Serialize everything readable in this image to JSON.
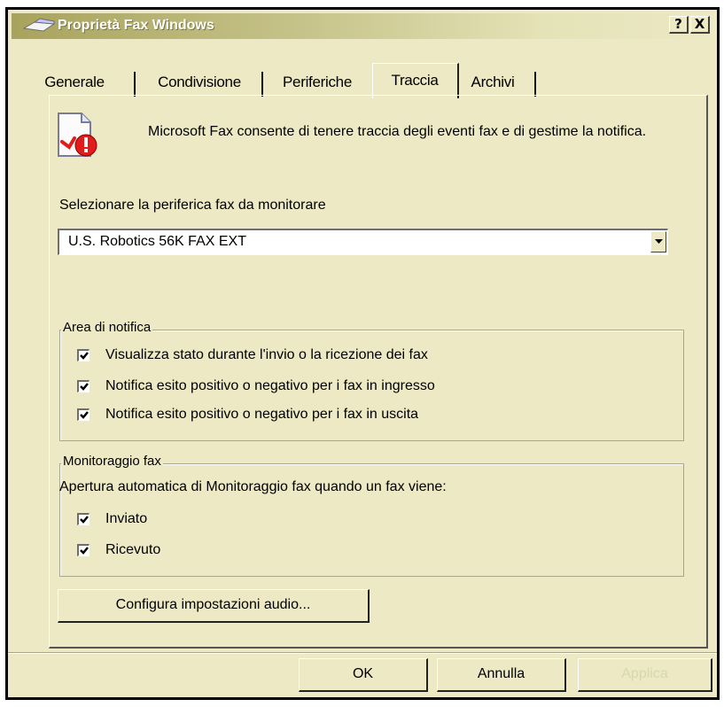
{
  "window": {
    "title": "Proprietà Fax Windows",
    "help_label": "?",
    "close_label": "X"
  },
  "tabs": [
    {
      "label": "Generale",
      "active": false
    },
    {
      "label": "Condivisione",
      "active": false
    },
    {
      "label": "Periferiche",
      "active": false
    },
    {
      "label": "Traccia",
      "active": true
    },
    {
      "label": "Archivi",
      "active": false
    }
  ],
  "intro": {
    "icon": "fax-tracking-icon",
    "text": "Microsoft Fax consente di tenere traccia degli eventi fax e di gestime la notifica."
  },
  "device": {
    "label": "Selezionare la periferica fax da monitorare",
    "selected": "U.S. Robotics 56K FAX EXT"
  },
  "notification_area": {
    "title": "Area di notifica",
    "options": [
      {
        "label": "Visualizza stato durante l'invio o la ricezione dei fax",
        "checked": true
      },
      {
        "label": "Notifica esito positivo o negativo per i fax in ingresso",
        "checked": true
      },
      {
        "label": "Notifica esito positivo o negativo per i fax in uscita",
        "checked": true
      }
    ]
  },
  "fax_monitor": {
    "title": "Monitoraggio fax",
    "description": "Apertura automatica di Monitoraggio fax quando un fax viene:",
    "options": [
      {
        "label": "Inviato",
        "checked": true
      },
      {
        "label": "Ricevuto",
        "checked": true
      }
    ]
  },
  "audio_button": "Configura impostazioni audio...",
  "footer": {
    "ok": "OK",
    "cancel": "Annulla",
    "apply": "Applica"
  },
  "colors": {
    "dialog_bg": "#ECE9C4",
    "title_text": "#FFFFFF",
    "disabled_text": "#D8D6AB"
  }
}
